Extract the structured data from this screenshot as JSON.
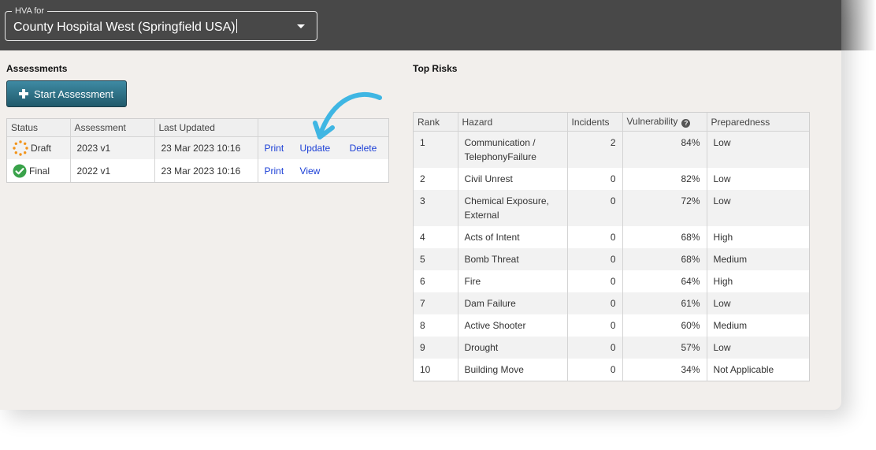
{
  "header": {
    "select_label": "HVA for",
    "select_value": "County Hospital West (Springfield USA)",
    "arrow_icon": "chevron-down-icon"
  },
  "assessments": {
    "title": "Assessments",
    "start_button_label": "Start Assessment",
    "columns": [
      "Status",
      "Assessment",
      "Last Updated",
      ""
    ],
    "rows": [
      {
        "status": "Draft",
        "status_icon": "draft-spinner-icon",
        "status_color": "#f2941b",
        "assessment": "2023 v1",
        "last_updated": "23 Mar 2023 10:16",
        "actions": [
          "Print",
          "Update",
          "Delete"
        ]
      },
      {
        "status": "Final",
        "status_icon": "check-circle-icon",
        "status_color": "#39a24a",
        "assessment": "2022 v1",
        "last_updated": "23 Mar 2023 10:16",
        "actions": [
          "Print",
          "View"
        ]
      }
    ]
  },
  "top_risks": {
    "title": "Top Risks",
    "columns": [
      "Rank",
      "Hazard",
      "Incidents",
      "Vulnerability",
      "Preparedness"
    ],
    "help_icon": "question-circle-icon",
    "rows": [
      {
        "rank": "1",
        "hazard": "Communication / TelephonyFailure",
        "incidents": "2",
        "vulnerability": "84%",
        "preparedness": "Low"
      },
      {
        "rank": "2",
        "hazard": "Civil Unrest",
        "incidents": "0",
        "vulnerability": "82%",
        "preparedness": "Low"
      },
      {
        "rank": "3",
        "hazard": "Chemical Exposure, External",
        "incidents": "0",
        "vulnerability": "72%",
        "preparedness": "Low"
      },
      {
        "rank": "4",
        "hazard": "Acts of Intent",
        "incidents": "0",
        "vulnerability": "68%",
        "preparedness": "High"
      },
      {
        "rank": "5",
        "hazard": "Bomb Threat",
        "incidents": "0",
        "vulnerability": "68%",
        "preparedness": "Medium"
      },
      {
        "rank": "6",
        "hazard": "Fire",
        "incidents": "0",
        "vulnerability": "64%",
        "preparedness": "High"
      },
      {
        "rank": "7",
        "hazard": "Dam Failure",
        "incidents": "0",
        "vulnerability": "61%",
        "preparedness": "Low"
      },
      {
        "rank": "8",
        "hazard": "Active Shooter",
        "incidents": "0",
        "vulnerability": "60%",
        "preparedness": "Medium"
      },
      {
        "rank": "9",
        "hazard": "Drought",
        "incidents": "0",
        "vulnerability": "57%",
        "preparedness": "Low"
      },
      {
        "rank": "10",
        "hazard": "Building Move",
        "incidents": "0",
        "vulnerability": "34%",
        "preparedness": "Not Applicable"
      }
    ]
  },
  "colors": {
    "header_bg": "#484848",
    "page_bg": "#f2efec",
    "button_teal": "#2f7489",
    "link": "#1a3ed6",
    "annotation_arrow": "#3fb6e3"
  },
  "annotation": {
    "icon": "curved-arrow-icon"
  }
}
